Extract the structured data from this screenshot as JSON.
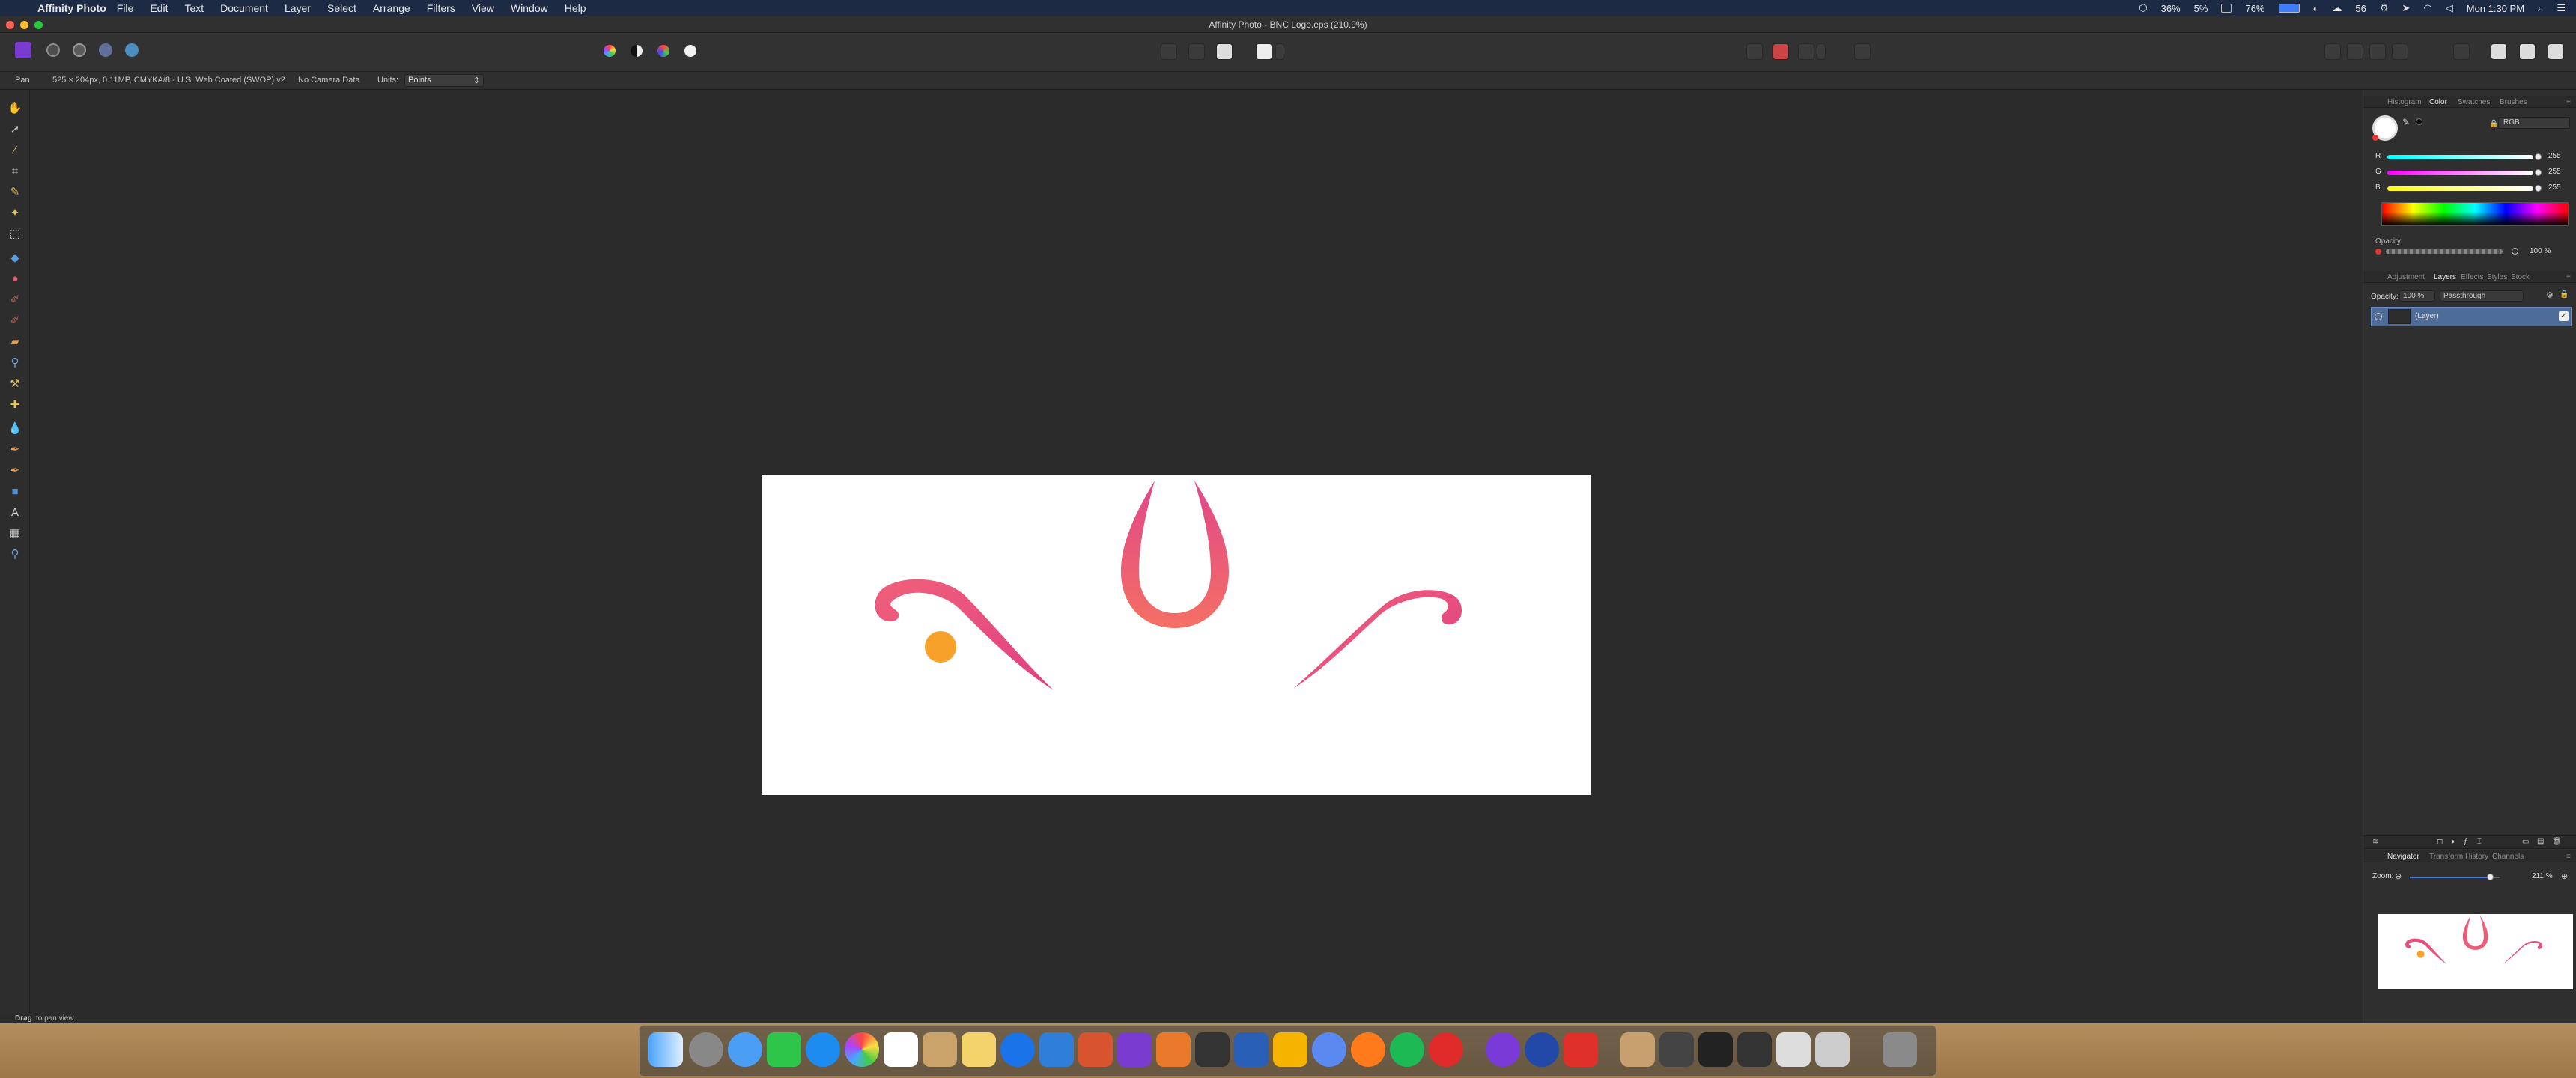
{
  "menubar": {
    "apple_symbol": "",
    "app_name": "Affinity Photo",
    "items": [
      "File",
      "Edit",
      "Text",
      "Document",
      "Layer",
      "Select",
      "Arrange",
      "Filters",
      "View",
      "Window",
      "Help"
    ],
    "status": {
      "battery_pct": "36%",
      "cpu_pct": "5%",
      "mem_pct": "76%",
      "count": "56",
      "clock": "Mon 1:30 PM"
    }
  },
  "window": {
    "title": "Affinity Photo - BNC Logo.eps (210.9%)"
  },
  "context_toolbar": {
    "tool_name": "Pan",
    "doc_info": "525 × 204px, 0.11MP, CMYKA/8 - U.S. Web Coated (SWOP) v2",
    "camera_data": "No Camera Data",
    "units_label": "Units:",
    "units_value": "Points"
  },
  "status_bar": {
    "hint_bold": "Drag",
    "hint_text": "to pan view."
  },
  "panels": {
    "top_tabs": [
      "Histogram",
      "Color",
      "Swatches",
      "Brushes"
    ],
    "top_active": "Color",
    "color_mode": "RGB",
    "channels": [
      {
        "label": "R",
        "value": "255"
      },
      {
        "label": "G",
        "value": "255"
      },
      {
        "label": "B",
        "value": "255"
      }
    ],
    "opacity_label": "Opacity",
    "opacity_value": "100 %",
    "layer_tabs": [
      "Adjustment",
      "Layers",
      "Effects",
      "Styles",
      "Stock"
    ],
    "layer_active": "Layers",
    "layer_opacity_label": "Opacity:",
    "layer_opacity_value": "100 %",
    "blend_mode": "Passthrough",
    "layer_name": "(Layer)",
    "nav_tabs": [
      "Navigator",
      "Transform",
      "History",
      "Channels"
    ],
    "nav_active": "Navigator",
    "zoom_label": "Zoom:",
    "zoom_value": "211 %"
  },
  "colors": {
    "accent": "#4f6c99",
    "logo_pink": "#e8507a",
    "logo_coral": "#f26a6a",
    "logo_orange": "#f7a12a"
  }
}
